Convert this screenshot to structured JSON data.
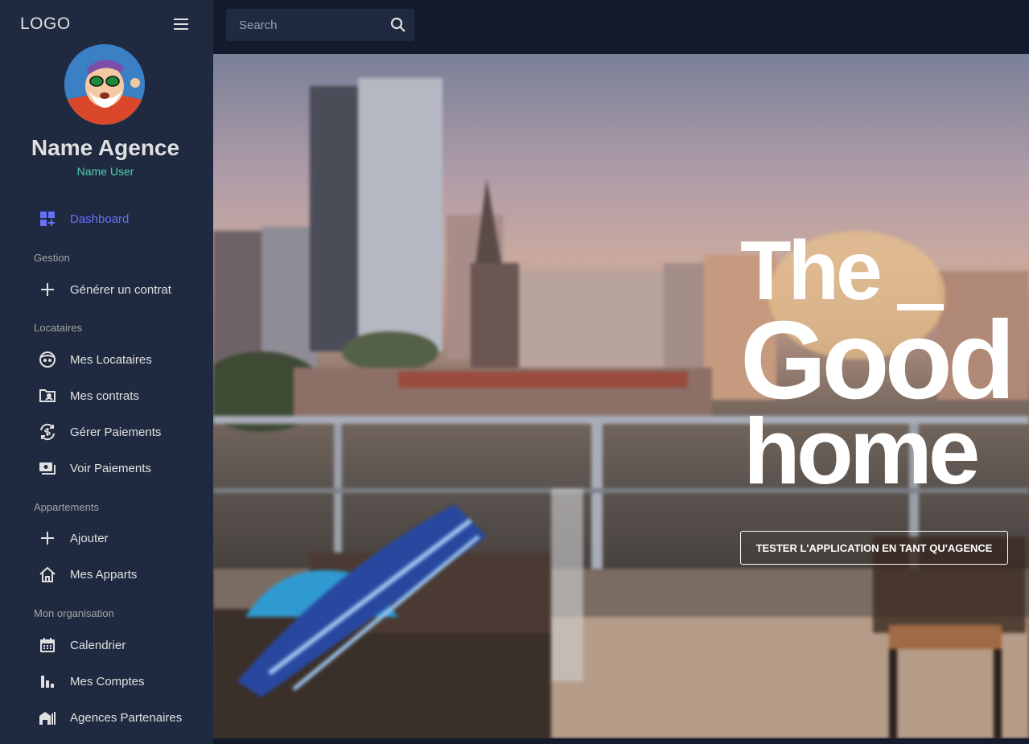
{
  "brand": {
    "logo": "LOGO",
    "accent_color": "#6870fa",
    "user_color": "#4cceac"
  },
  "profile": {
    "agency_name": "Name Agence",
    "user_name": "Name User"
  },
  "sidebar": {
    "dashboard": {
      "label": "Dashboard",
      "icon": "dashboard-icon",
      "active": true
    },
    "sections": [
      {
        "title": "Gestion",
        "items": [
          {
            "label": "Générer un contrat",
            "icon": "plus-icon"
          }
        ]
      },
      {
        "title": "Locataires",
        "items": [
          {
            "label": "Mes Locataires",
            "icon": "face-icon"
          },
          {
            "label": "Mes contrats",
            "icon": "folder-user-icon"
          },
          {
            "label": "Gérer Paiements",
            "icon": "currency-exchange-icon"
          },
          {
            "label": "Voir Paiements",
            "icon": "payments-icon"
          }
        ]
      },
      {
        "title": "Appartements",
        "items": [
          {
            "label": "Ajouter",
            "icon": "plus-icon"
          },
          {
            "label": "Mes Apparts",
            "icon": "house-icon"
          }
        ]
      },
      {
        "title": "Mon organisation",
        "items": [
          {
            "label": "Calendrier",
            "icon": "calendar-icon"
          },
          {
            "label": "Mes Comptes",
            "icon": "bar-chart-icon"
          },
          {
            "label": "Agences Partenaires",
            "icon": "buildings-icon"
          }
        ]
      }
    ]
  },
  "search": {
    "placeholder": "Search",
    "value": ""
  },
  "hero": {
    "line1": "The",
    "line2": "Good",
    "line3": "home",
    "cta_label": "TESTER L'APPLICATION EN TANT QU'AGENCE"
  }
}
